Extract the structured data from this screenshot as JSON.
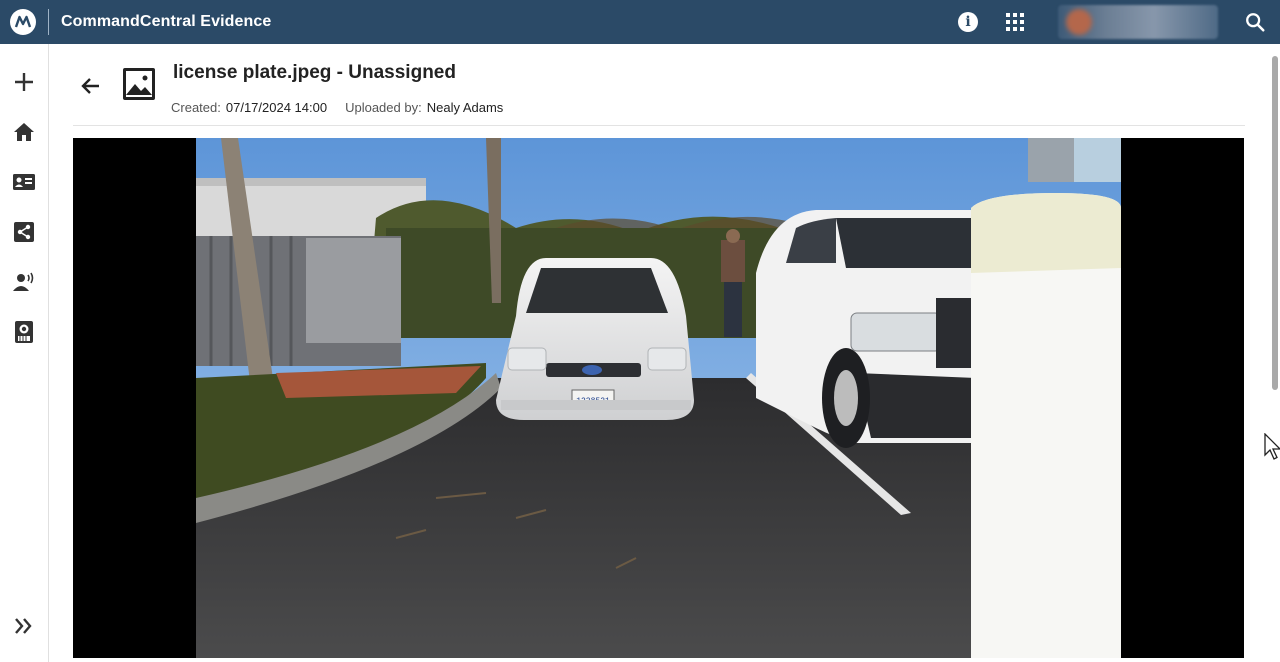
{
  "app": {
    "title": "CommandCentral Evidence",
    "logo": "motorola-logo-icon",
    "accent": "#2b4a67"
  },
  "topbar": {
    "icons": [
      "info-icon",
      "apps-grid-icon",
      "user-avatar",
      "search-icon"
    ]
  },
  "sidebar": {
    "items": [
      {
        "icon": "plus-icon"
      },
      {
        "icon": "home-icon"
      },
      {
        "icon": "id-card-icon"
      },
      {
        "icon": "share-icon"
      },
      {
        "icon": "person-broadcast-icon"
      },
      {
        "icon": "body-camera-icon"
      },
      {
        "icon": "expand-chevrons-icon"
      }
    ]
  },
  "evidence": {
    "title": "license plate.jpeg - Unassigned",
    "created_label": "Created:",
    "created_value": "07/17/2024 14:00",
    "uploaded_label": "Uploaded by:",
    "uploaded_value": "Nealy Adams"
  },
  "viewer": {
    "plate_text": "1228521",
    "background": "#000000"
  }
}
